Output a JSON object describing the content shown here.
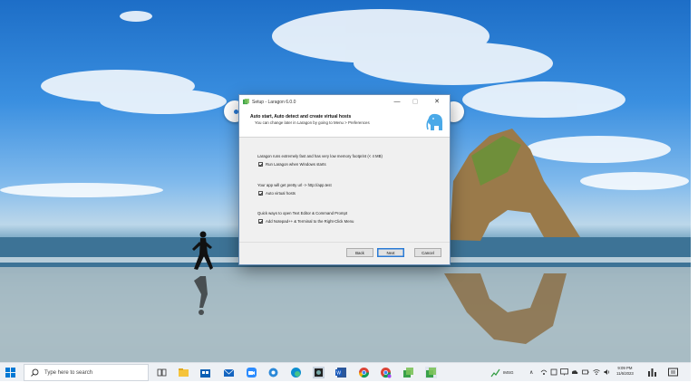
{
  "window": {
    "title": "Setup - Laragon 6.0.0",
    "controls": {
      "minimize": "—",
      "maximize": "▢",
      "close": "✕"
    },
    "header_title": "Auto start, Auto detect and create virtual hosts",
    "header_subtitle": "You can change later in Laragon by going to Menu > Preferences",
    "sections": [
      {
        "text": "Laragon runs extremely fast and has very low memory footprint (< 4 MB)",
        "option": "Run Laragon when Windows starts",
        "checked": true
      },
      {
        "text": "Your app will get pretty url -> http://app.test",
        "option": "Auto virtual hosts",
        "checked": true
      },
      {
        "text": "Quick ways to open Text Editor & Command Prompt",
        "option": "Add Notepad++ & Terminal to the Right-Click Menu",
        "checked": true
      }
    ],
    "buttons": {
      "back": "Back",
      "next": "Next",
      "cancel": "Cancel"
    }
  },
  "taskbar": {
    "search_placeholder": "Type here to search",
    "pinned_icons": [
      "task-view-icon",
      "file-explorer-icon",
      "store-icon",
      "mail-icon",
      "zoom-icon",
      "photos-icon",
      "edge-icon",
      "media-icon",
      "word-icon",
      "chrome-icon",
      "chrome-profile-icon",
      "setup-icon",
      "laragon-setup-icon"
    ],
    "tray": {
      "stock_label": "IMSG",
      "time": "9:09 PM",
      "date": "11/6/2023"
    }
  },
  "colors": {
    "accent": "#2a7bd6",
    "window_bg": "#f0f0f0",
    "taskbar_bg": "#eef1f5"
  }
}
